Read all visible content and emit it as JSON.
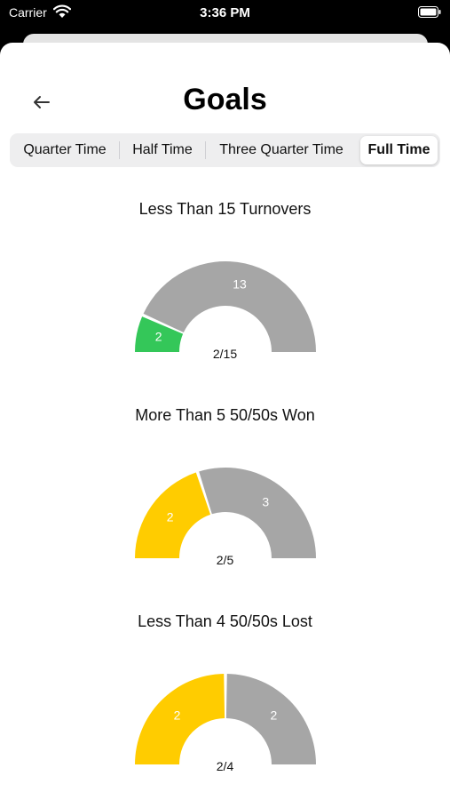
{
  "status_bar": {
    "carrier": "Carrier",
    "time": "3:36 PM"
  },
  "header": {
    "title": "Goals"
  },
  "tabs": [
    {
      "label": "Quarter Time",
      "selected": false
    },
    {
      "label": "Half Time",
      "selected": false
    },
    {
      "label": "Three Quarter Time",
      "selected": false
    },
    {
      "label": "Full Time",
      "selected": true
    }
  ],
  "colors": {
    "achieved_green": "#34c759",
    "achieved_yellow": "#ffcc00",
    "remaining_gray": "#a6a6a6"
  },
  "goals": [
    {
      "title": "Less Than 15 Turnovers",
      "ratio": "2/15",
      "achieved_label": "2",
      "remaining_label": "13",
      "achieved": 2,
      "target": 15,
      "color": "#34c759"
    },
    {
      "title": "More Than 5 50/50s Won",
      "ratio": "2/5",
      "achieved_label": "2",
      "remaining_label": "3",
      "achieved": 2,
      "target": 5,
      "color": "#ffcc00"
    },
    {
      "title": "Less Than 4 50/50s Lost",
      "ratio": "2/4",
      "achieved_label": "2",
      "remaining_label": "2",
      "achieved": 2,
      "target": 4,
      "color": "#ffcc00"
    }
  ]
}
